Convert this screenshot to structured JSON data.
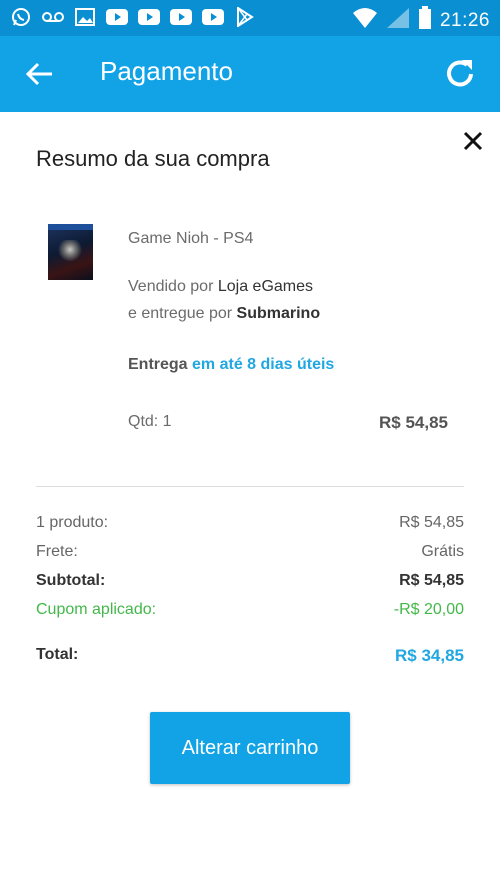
{
  "status_bar": {
    "time": "21:26",
    "left_icons": [
      "whatsapp-icon",
      "voicemail-icon",
      "image-icon",
      "youtube-icon",
      "youtube-icon",
      "youtube-icon",
      "youtube-icon",
      "play-store-icon"
    ],
    "right_icons": [
      "wifi-icon",
      "signal-icon",
      "battery-icon"
    ]
  },
  "app_bar": {
    "title": "Pagamento",
    "back_icon": "arrow-back-icon",
    "refresh_icon": "refresh-icon"
  },
  "summary": {
    "heading": "Resumo da sua compra",
    "close_icon": "close-icon",
    "product": {
      "name": "Game Nioh - PS4",
      "sold_by_prefix": "Vendido por ",
      "seller": "Loja eGames",
      "delivered_by_prefix": "e entregue por ",
      "carrier": "Submarino",
      "delivery_prefix": "Entrega ",
      "delivery_time": "em até 8 dias úteis",
      "qty_label": "Qtd: 1",
      "price": "R$ 54,85"
    },
    "totals": {
      "products_label": "1 produto:",
      "products_value": "R$ 54,85",
      "shipping_label": "Frete:",
      "shipping_value": "Grátis",
      "subtotal_label": "Subtotal:",
      "subtotal_value": "R$ 54,85",
      "coupon_label": "Cupom aplicado:",
      "coupon_value": "-R$ 20,00",
      "total_label": "Total:",
      "total_value": "R$ 34,85"
    },
    "cart_button_label": "Alterar carrinho"
  },
  "colors": {
    "primary": "#12a3e6",
    "status_bar": "#0a8fd2",
    "accent_text": "#21a7e2",
    "coupon_green": "#43b84a"
  }
}
